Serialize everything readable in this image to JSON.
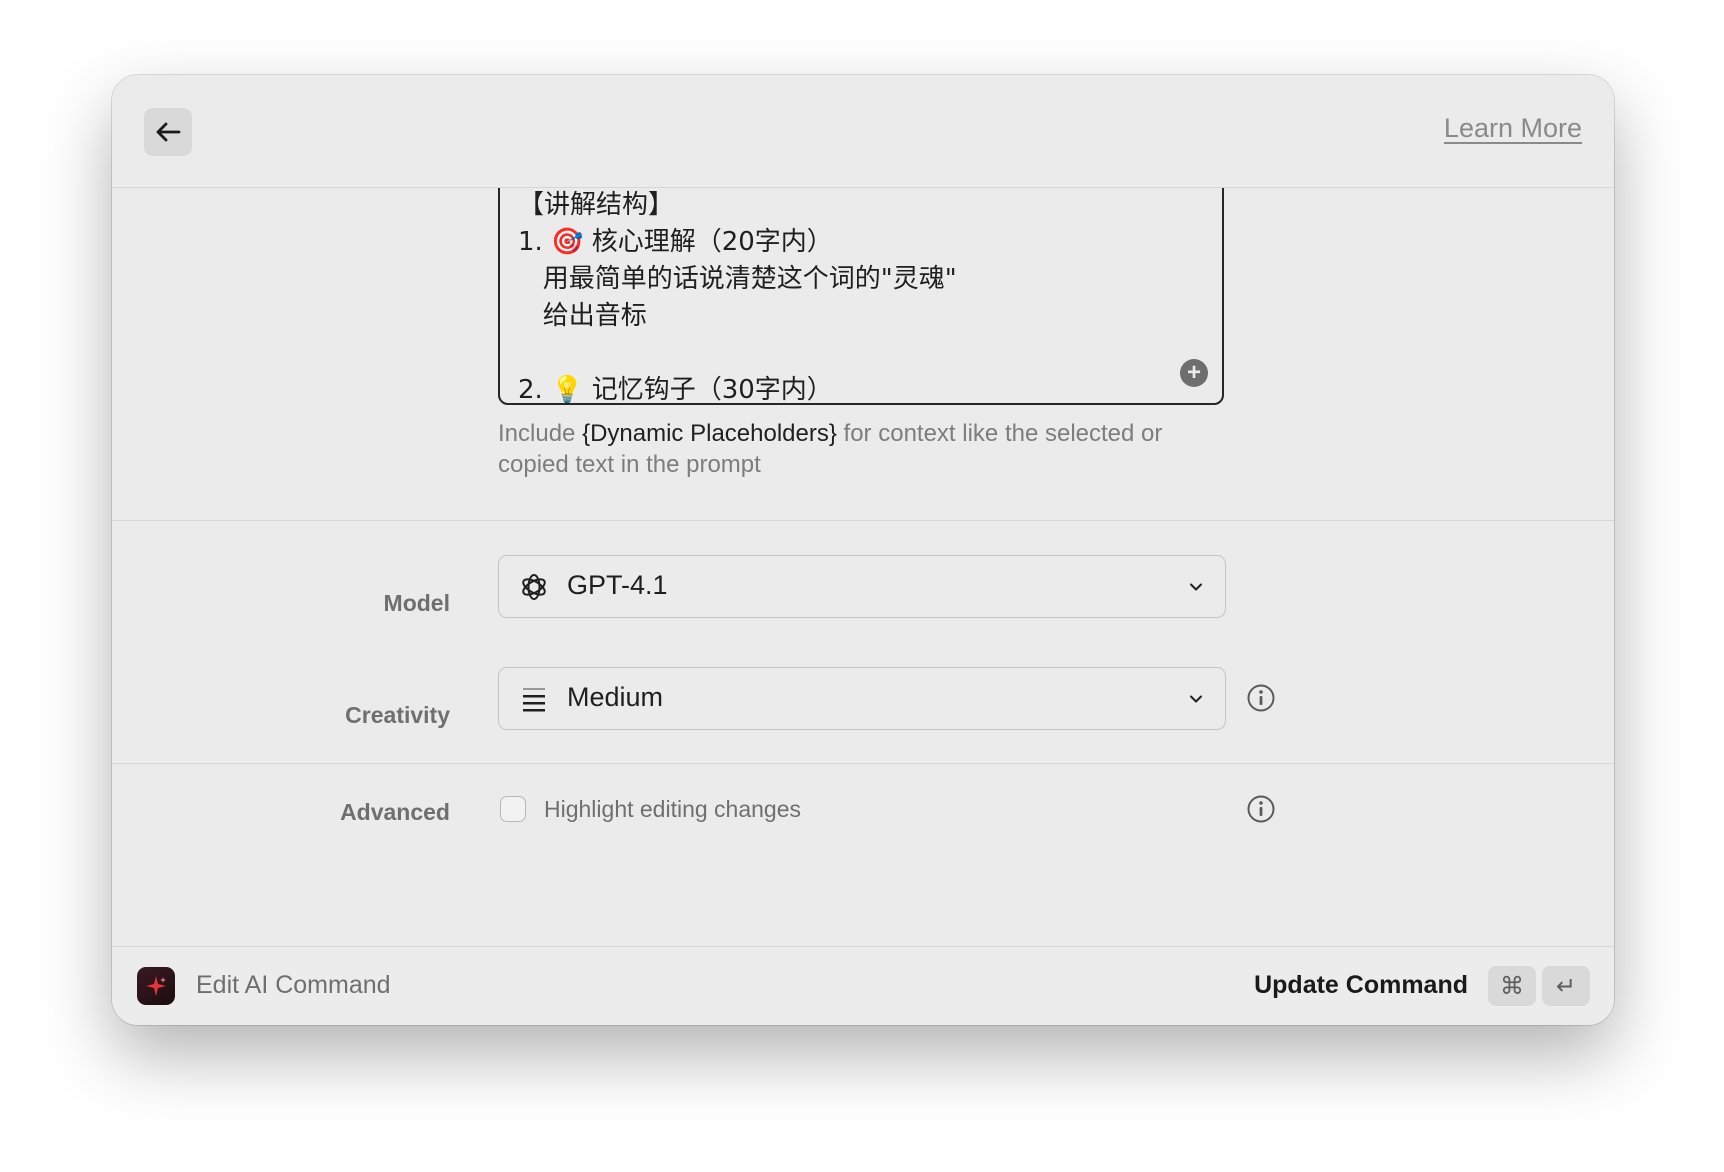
{
  "header": {
    "back_icon": "arrow-left-icon",
    "learn_more": "Learn More"
  },
  "prompt": {
    "text": "【讲解结构】\n1. 🎯 核心理解（20字内）\n   用最简单的话说清楚这个词的\"灵魂\"\n   给出音标\n\n2. 💡 记忆钩子（30字内）",
    "add_icon": "plus-circle-icon"
  },
  "hint": {
    "before": "Include ",
    "highlight": "{Dynamic Placeholders}",
    "after": " for context like the selected or copied text in the prompt"
  },
  "model": {
    "label": "Model",
    "value": "GPT-4.1",
    "icon": "openai-icon"
  },
  "creativity": {
    "label": "Creativity",
    "value": "Medium",
    "icon": "medium-bars-icon"
  },
  "advanced": {
    "label": "Advanced",
    "checkbox_label": "Highlight editing changes",
    "checked": false
  },
  "footer": {
    "title": "Edit AI Command",
    "action": "Update Command",
    "shortcut_keys": [
      "⌘",
      "↵"
    ]
  },
  "colors": {
    "window_bg": "#ebebeb",
    "accent_icon": "#e8323d"
  }
}
